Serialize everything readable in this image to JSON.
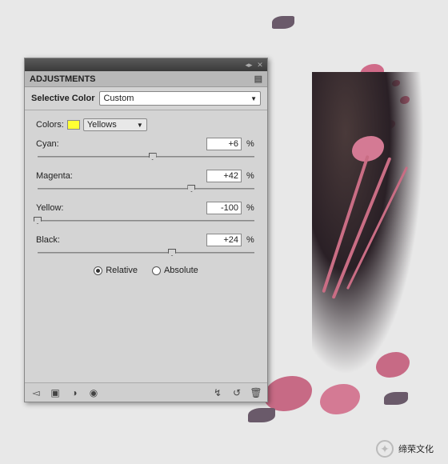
{
  "panel": {
    "tab_label": "ADJUSTMENTS",
    "title": "Selective Color",
    "preset": "Custom",
    "colors_label": "Colors:",
    "colors_value": "Yellows",
    "sliders": [
      {
        "label": "Cyan:",
        "value": "+6",
        "pos": 53
      },
      {
        "label": "Magenta:",
        "value": "+42",
        "pos": 71
      },
      {
        "label": "Yellow:",
        "value": "-100",
        "pos": 0
      },
      {
        "label": "Black:",
        "value": "+24",
        "pos": 62
      }
    ],
    "percent": "%",
    "mode": {
      "relative": "Relative",
      "absolute": "Absolute",
      "selected": "relative"
    },
    "footer_icons": [
      "back",
      "adjust",
      "mask",
      "eye",
      "clip",
      "reset",
      "trash"
    ]
  },
  "watermark": {
    "icon": "✦",
    "text": "缔荣文化"
  }
}
